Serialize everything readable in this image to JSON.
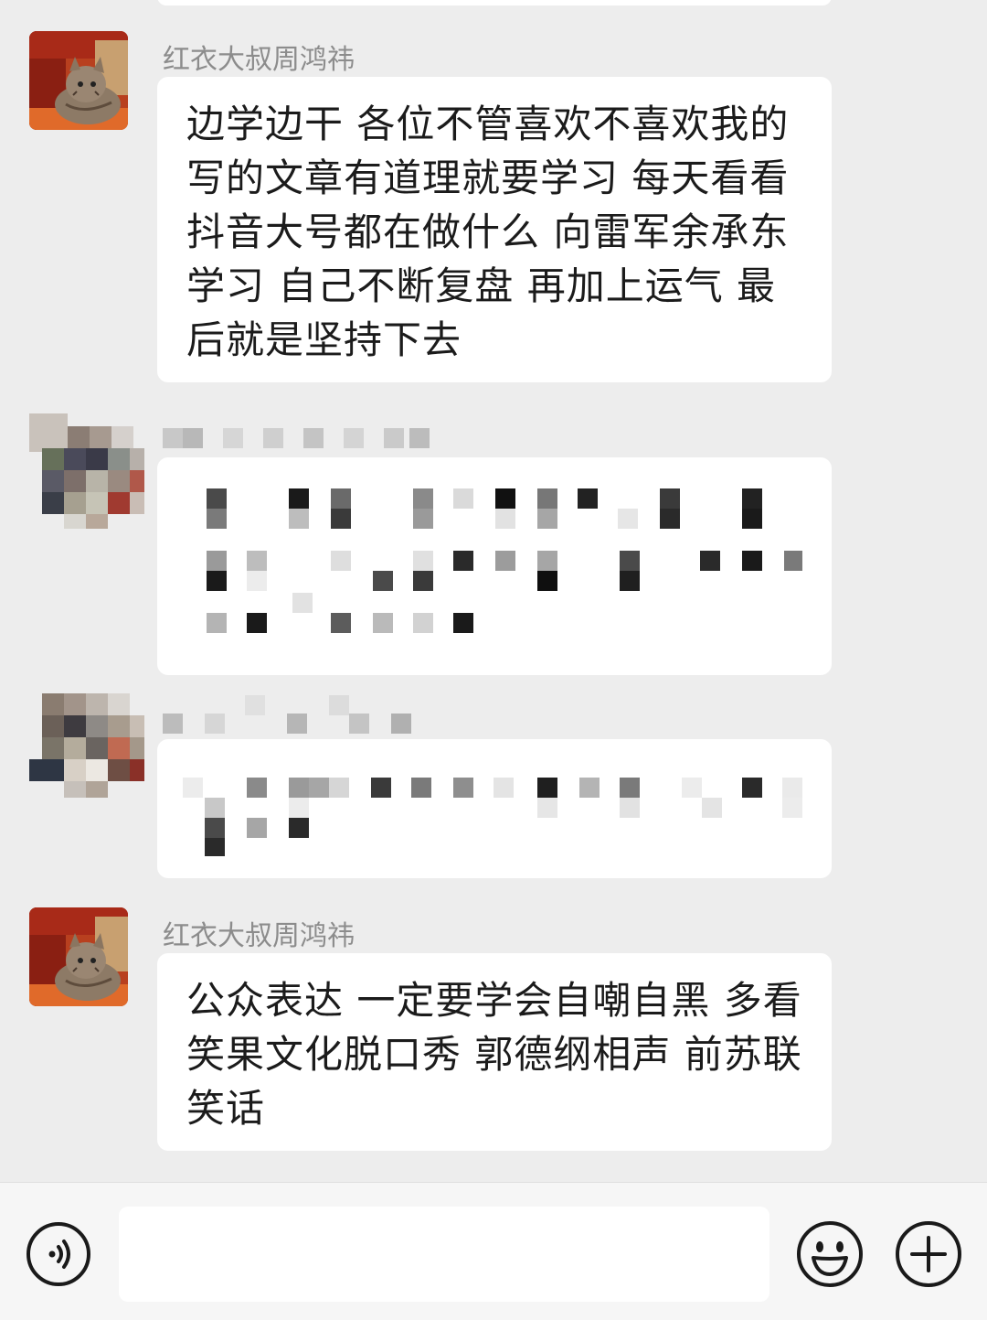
{
  "messages": [
    {
      "sender": "红衣大叔周鸿祎",
      "text": "边学边干 各位不管喜欢不喜欢我的 写的文章有道理就要学习 每天看看抖音大号都在做什么 向雷军余承东学习 自己不断复盘 再加上运气 最后就是坚持下去"
    },
    {
      "sender": "红衣大叔周鸿祎",
      "text": "公众表达 一定要学会自嘲自黑 多看笑果文化脱口秀 郭德纲相声 前苏联笑话"
    }
  ],
  "input": {
    "value": ""
  },
  "icons": {
    "voice": "voice-icon",
    "emoji": "emoji-icon",
    "plus": "plus-icon"
  },
  "colors": {
    "background": "#ededed",
    "bubble": "#ffffff",
    "name": "#8c8c8c",
    "text": "#1b1b1b"
  }
}
